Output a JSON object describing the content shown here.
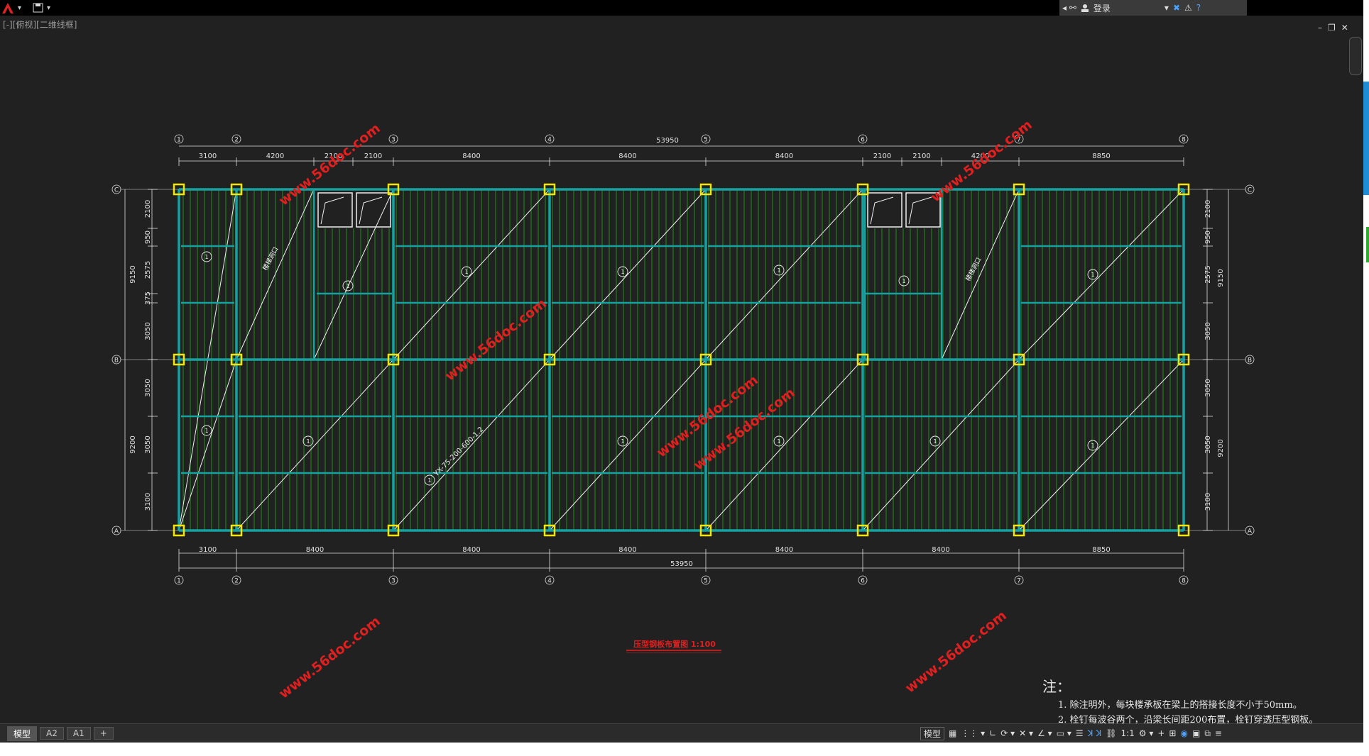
{
  "app": {
    "menu_arrow": "▾",
    "infocenter": {
      "login_label": "登录"
    },
    "view_label": "[-][俯视][二维线框]",
    "window_controls": [
      "–",
      "❐",
      "✕"
    ]
  },
  "drawing": {
    "grid_columns": [
      "1",
      "2",
      "3",
      "4",
      "5",
      "6",
      "7",
      "8"
    ],
    "grid_rows": [
      "C",
      "B",
      "A"
    ],
    "top_total": "53950",
    "top_dims": [
      "3100",
      "4200",
      "2100",
      "2100",
      "8400",
      "8400",
      "8400",
      "2100",
      "2100",
      "4200",
      "8850"
    ],
    "bottom_total": "53950",
    "bottom_dims": [
      "3100",
      "8400",
      "8400",
      "8400",
      "8400",
      "8400",
      "8850"
    ],
    "left_dims_inner": [
      "2100",
      "950",
      "2575",
      "375",
      "3050",
      "3050",
      "3050",
      "3100"
    ],
    "left_dims_outer": [
      "9150",
      "9200"
    ],
    "right_dims_inner": [
      "2100",
      "950",
      "2575",
      "3050",
      "3050",
      "3050",
      "3100"
    ],
    "right_dims_outer": [
      "9150",
      "9200"
    ],
    "stair_label": "楼梯洞口",
    "deck_spec": "YX-75-200-600-1.2",
    "panel_mark": "1",
    "watermark": "www.56doc.com",
    "title": "压型钢板布置图  1:100"
  },
  "notes": {
    "heading": "注：",
    "lines": [
      "1. 除注明外，每块楼承板在梁上的搭接长度不小于50mm。",
      "2. 栓钉每波谷两个，沿梁长间距200布置，栓钉穿透压型钢板。"
    ]
  },
  "statusbar": {
    "tabs": [
      "模型",
      "A2",
      "A1",
      "+"
    ],
    "model_label": "模型",
    "scale": "1:1"
  },
  "colors": {
    "canvas_bg": "#212121",
    "beam": "#14a3a0",
    "deck": "#1f8f1f",
    "column": "#f3e40a",
    "dim": "#e0e0e0",
    "watermark": "#e11f1f",
    "title": "#e11f1f"
  }
}
